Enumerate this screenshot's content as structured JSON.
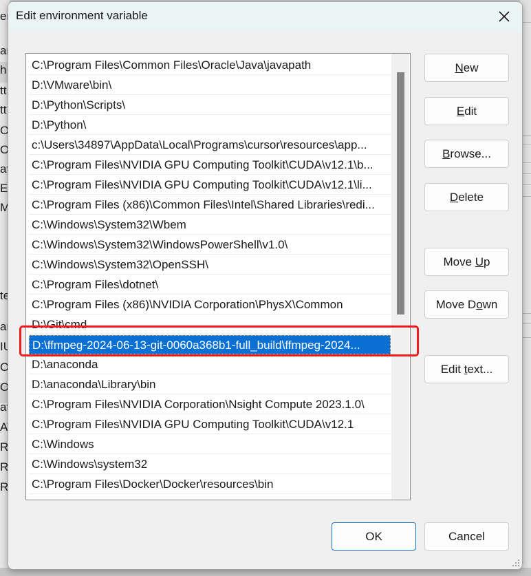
{
  "background_window": {
    "left_fragments": [
      "er",
      "ar",
      "h",
      "tt",
      "tt",
      "On",
      "On",
      "at",
      "EN",
      "M",
      "te",
      "ar",
      "IU",
      "OL",
      "OS",
      "at",
      "AT",
      "R",
      "R",
      "R"
    ]
  },
  "dialog": {
    "title": "Edit environment variable",
    "close_icon": "close-icon",
    "selected_index": 13,
    "path_entries": [
      "C:\\Program Files\\Common Files\\Oracle\\Java\\javapath",
      "D:\\VMware\\bin\\",
      "D:\\Python\\Scripts\\",
      "D:\\Python\\",
      "c:\\Users\\34897\\AppData\\Local\\Programs\\cursor\\resources\\app...",
      "C:\\Program Files\\NVIDIA GPU Computing Toolkit\\CUDA\\v12.1\\b...",
      "C:\\Program Files\\NVIDIA GPU Computing Toolkit\\CUDA\\v12.1\\li...",
      "C:\\Program Files (x86)\\Common Files\\Intel\\Shared Libraries\\redi...",
      "C:\\Windows\\System32\\Wbem",
      "C:\\Windows\\System32\\WindowsPowerShell\\v1.0\\",
      "C:\\Windows\\System32\\OpenSSH\\",
      "C:\\Program Files\\dotnet\\",
      "C:\\Program Files (x86)\\NVIDIA Corporation\\PhysX\\Common",
      "D:\\ffmpeg-2024-06-13-git-0060a368b1-full_build\\ffmpeg-2024...",
      "D:\\Git\\cmd",
      "D:\\anaconda",
      "D:\\anaconda\\Library\\bin",
      "C:\\Program Files\\NVIDIA Corporation\\Nsight Compute 2023.1.0\\",
      "C:\\Program Files\\NVIDIA GPU Computing Toolkit\\CUDA\\v12.1",
      "C:\\Windows",
      "C:\\Windows\\system32",
      "C:\\Program Files\\Docker\\Docker\\resources\\bin"
    ],
    "buttons": {
      "new": {
        "pre": "",
        "key": "N",
        "post": "ew"
      },
      "edit": {
        "pre": "",
        "key": "E",
        "post": "dit"
      },
      "browse": {
        "pre": "",
        "key": "B",
        "post": "rowse..."
      },
      "delete": {
        "pre": "",
        "key": "D",
        "post": "elete"
      },
      "move_up": {
        "pre": "Move ",
        "key": "U",
        "post": "p"
      },
      "move_down": {
        "pre": "Move D",
        "key": "o",
        "post": "wn"
      },
      "edit_text": {
        "pre": "Edit ",
        "key": "t",
        "post": "ext..."
      },
      "ok": "OK",
      "cancel": "Cancel"
    },
    "annotation": {
      "color": "#f01c1c",
      "target": "selected-entry"
    },
    "colors": {
      "selection": "#0a70d4",
      "titlebar": "#eaf4f5",
      "primary_border": "#1a6fc0"
    }
  }
}
